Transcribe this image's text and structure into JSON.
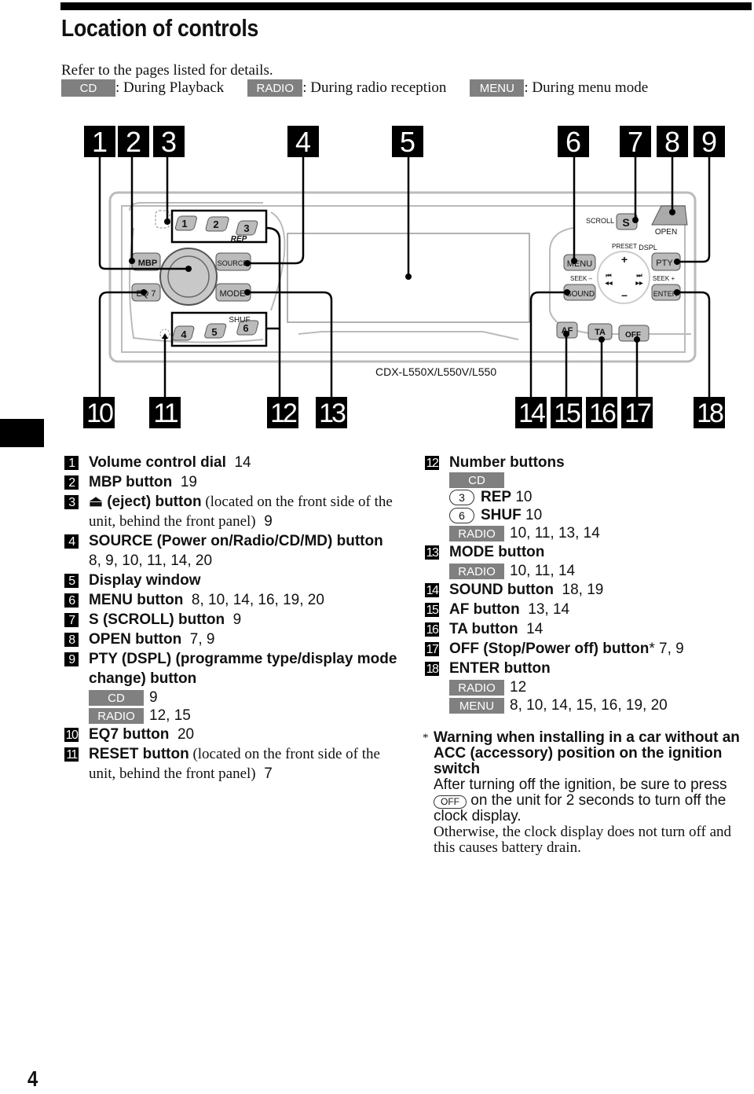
{
  "page": {
    "title": "Location of controls",
    "intro": "Refer to the pages listed for details.",
    "legend": [
      {
        "badge": "CD",
        "text": ": During Playback"
      },
      {
        "badge": "RADIO",
        "text": ": During radio reception"
      },
      {
        "badge": "MENU",
        "text": ": During menu mode"
      }
    ],
    "page_number": "4",
    "accent_color": "#808080"
  },
  "diagram": {
    "model": "CDX-L550X/L550V/L550",
    "top_callouts": [
      "1",
      "2",
      "3",
      "4",
      "5",
      "6",
      "7",
      "8",
      "9"
    ],
    "bottom_callouts": [
      "10",
      "11",
      "12",
      "13",
      "14",
      "15",
      "16",
      "17",
      "18"
    ],
    "buttons": {
      "preset_1": "1",
      "preset_2": "2",
      "preset_3": "3",
      "rep": "REP",
      "preset_4": "4",
      "preset_5": "5",
      "preset_6": "6",
      "shuf": "SHUF",
      "mbp": "MBP",
      "eq7": "EQ 7",
      "source": "SOURCE",
      "mode": "MODE",
      "scroll_label": "SCROLL",
      "s": "S",
      "open": "OPEN",
      "preset_label": "PRESET",
      "dspl": "DSPL",
      "menu": "MENU",
      "pty": "PTY",
      "seek_minus": "SEEK –",
      "seek_plus": "SEEK +",
      "sound": "SOUND",
      "enter": "ENTER",
      "plus": "+",
      "minus": "–",
      "prev": "⏮",
      "next": "⏭",
      "rew": "◀◀",
      "ff": "▶▶",
      "af": "AF",
      "ta": "TA",
      "off": "OFF"
    }
  },
  "left_column": [
    {
      "num": "1",
      "bold": "Volume control dial",
      "rest": "",
      "pages": "14"
    },
    {
      "num": "2",
      "bold": "MBP button",
      "rest": "",
      "pages": "19"
    },
    {
      "num": "3",
      "bold": "⏏ (eject) button",
      "rest": " (located on the front side of the unit, behind the front panel)",
      "pages": "9"
    },
    {
      "num": "4",
      "bold": "SOURCE (Power on/Radio/CD/MD) button",
      "rest": "",
      "pages": "8, 9, 10, 11, 14, 20"
    },
    {
      "num": "5",
      "bold": "Display window",
      "rest": "",
      "pages": ""
    },
    {
      "num": "6",
      "bold": "MENU button",
      "rest": "",
      "pages": "8, 10, 14, 16, 19, 20"
    },
    {
      "num": "7",
      "bold": "S (SCROLL) button",
      "rest": "",
      "pages": "9"
    },
    {
      "num": "8",
      "bold": "OPEN button",
      "rest": "",
      "pages": "7, 9"
    },
    {
      "num": "9",
      "bold": "PTY (DSPL) (programme type/display mode change) button",
      "rest": "",
      "pages": "",
      "subs": [
        {
          "badge": "CD",
          "pages": "9"
        },
        {
          "badge": "RADIO",
          "pages": "12, 15"
        }
      ]
    },
    {
      "num": "10",
      "bold": "EQ7 button",
      "rest": "",
      "pages": "20"
    },
    {
      "num": "11",
      "bold": "RESET button",
      "rest": " (located on the front side of the unit, behind the front panel)",
      "pages": "7"
    }
  ],
  "right_column": {
    "e12": {
      "num": "12",
      "bold": "Number buttons",
      "cd_badge": "CD",
      "rep": {
        "circle": "3",
        "label": "REP",
        "pages": "10"
      },
      "shuf": {
        "circle": "6",
        "label": "SHUF",
        "pages": "10"
      },
      "radio_badge": "RADIO",
      "radio_pages": "10, 11, 13, 14"
    },
    "e13": {
      "num": "13",
      "bold": "MODE button",
      "radio_badge": "RADIO",
      "radio_pages": "10, 11, 14"
    },
    "e14": {
      "num": "14",
      "bold": "SOUND button",
      "pages": "18, 19"
    },
    "e15": {
      "num": "15",
      "bold": "AF button",
      "pages": "13, 14"
    },
    "e16": {
      "num": "16",
      "bold": "TA button",
      "pages": "14"
    },
    "e17": {
      "num": "17",
      "bold": "OFF (Stop/Power off) button",
      "star": "*",
      "pages": "7, 9"
    },
    "e18": {
      "num": "18",
      "bold": "ENTER button",
      "radio_badge": "RADIO",
      "radio_pages": "12",
      "menu_badge": "MENU",
      "menu_pages": "8, 10, 14, 15, 16, 19, 20"
    }
  },
  "footnote": {
    "star": "*",
    "heading": "Warning when installing in a car without an ACC (accessory) position on the ignition switch",
    "line1_before": "After turning off the ignition, be sure to press",
    "off_key": "OFF",
    "line1_after": " on the unit for 2 seconds to turn off the clock display.",
    "line2": "Otherwise, the clock display does not turn off and this causes battery drain."
  }
}
